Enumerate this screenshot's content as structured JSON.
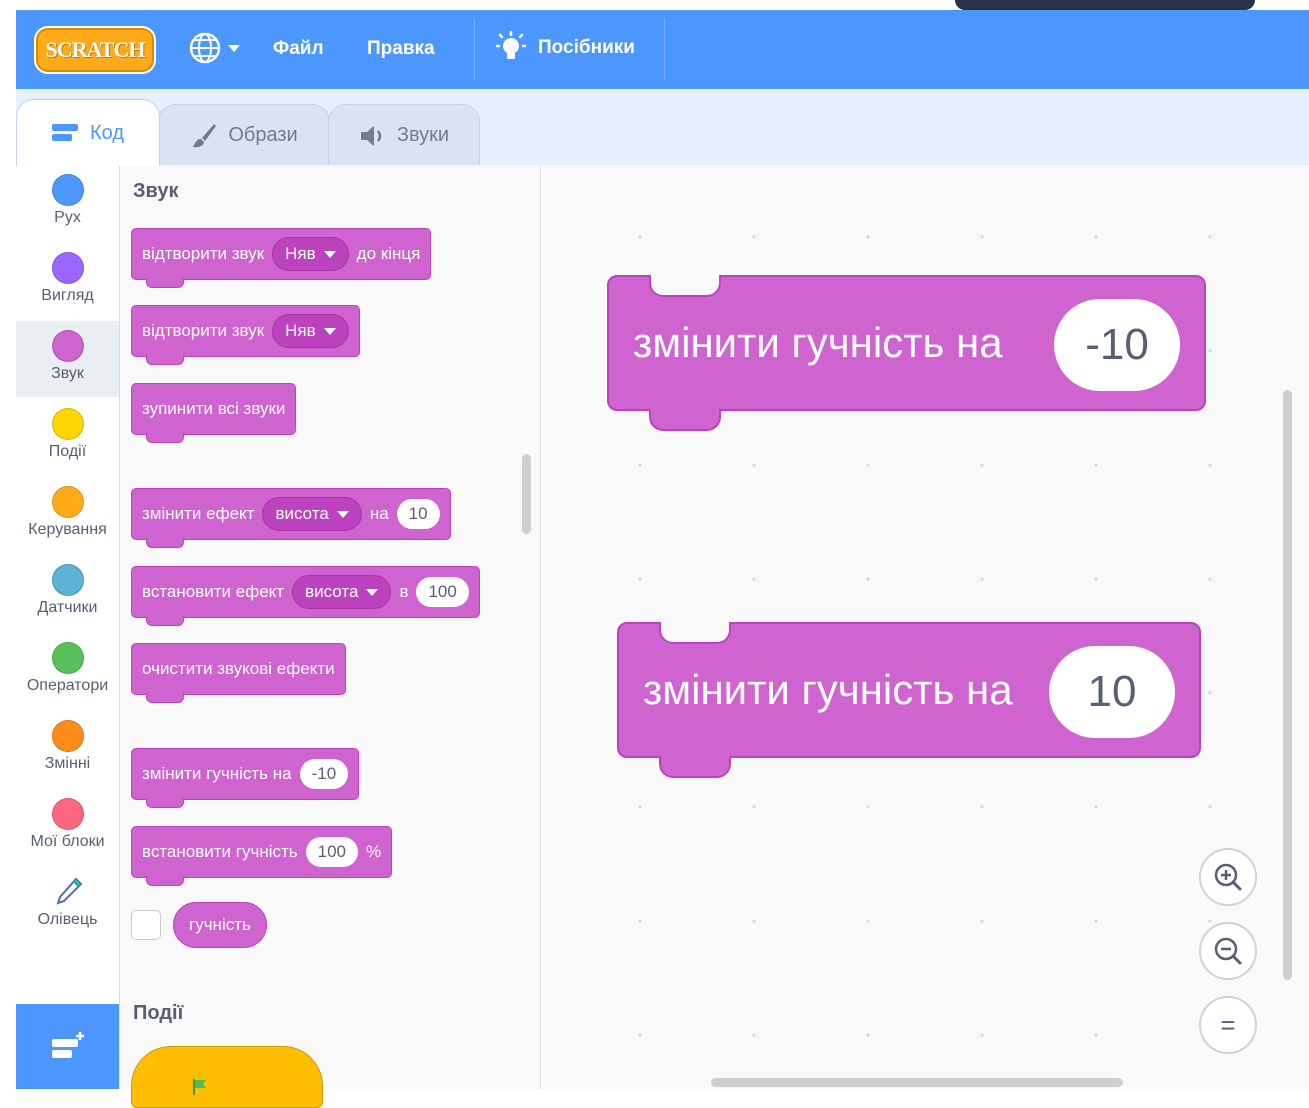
{
  "menubar": {
    "logo": "SCRATCH",
    "file": "Файл",
    "edit": "Правка",
    "tutorials": "Посібники"
  },
  "tabs": [
    {
      "label": "Код"
    },
    {
      "label": "Образи"
    },
    {
      "label": "Звуки"
    }
  ],
  "categories": [
    {
      "label": "Рух",
      "color": "#4C97FF"
    },
    {
      "label": "Вигляд",
      "color": "#9966FF"
    },
    {
      "label": "Звук",
      "color": "#CF63CF"
    },
    {
      "label": "Події",
      "color": "#FFD500"
    },
    {
      "label": "Керування",
      "color": "#FFAB19"
    },
    {
      "label": "Датчики",
      "color": "#5CB1D6"
    },
    {
      "label": "Оператори",
      "color": "#59C059"
    },
    {
      "label": "Змінні",
      "color": "#FF8C1A"
    },
    {
      "label": "Мої блоки",
      "color": "#FF6680"
    },
    {
      "label": "Олівець",
      "color": "#0fBD8C"
    }
  ],
  "palette": {
    "sound_title": "Звук",
    "events_title": "Події",
    "b1": {
      "text": "відтворити звук",
      "dd": "Няв",
      "tail": "до кінця"
    },
    "b2": {
      "text": "відтворити звук",
      "dd": "Няв"
    },
    "b3": {
      "text": "зупинити всі звуки"
    },
    "b4": {
      "text": "змінити ефект",
      "dd": "висота",
      "mid": "на",
      "num": "10"
    },
    "b5": {
      "text": "встановити ефект",
      "dd": "висота",
      "mid": "в",
      "num": "100"
    },
    "b6": {
      "text": "очистити звукові ефекти"
    },
    "b7": {
      "text": "змінити гучність на",
      "num": "-10"
    },
    "b8": {
      "text": "встановити гучність",
      "num": "100",
      "tail": "%"
    },
    "b9": {
      "text": "гучність"
    }
  },
  "workspace": {
    "block1": {
      "text": "змінити гучність на",
      "num": "-10"
    },
    "block2": {
      "text": "змінити гучність на",
      "num": "10"
    }
  },
  "zoom": {
    "reset": "="
  }
}
